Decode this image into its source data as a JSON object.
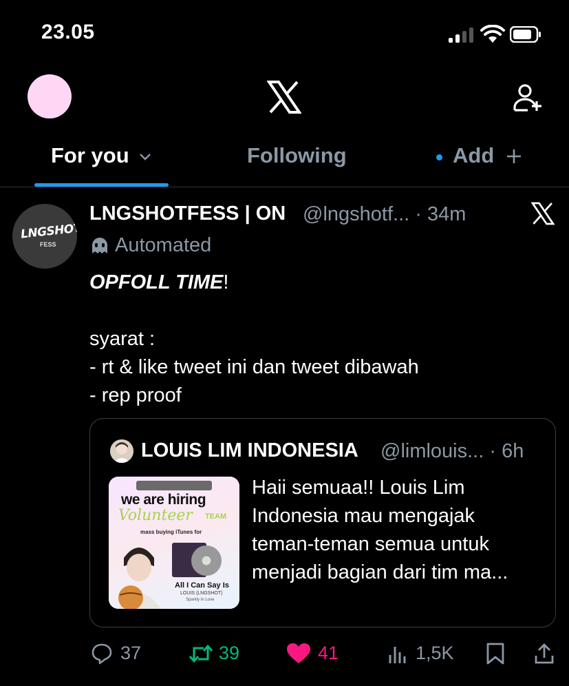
{
  "status_bar": {
    "time": "23.05"
  },
  "header": {
    "avatar_color": "#ffd7f4",
    "logo": "x-logo-icon",
    "add_account_icon": "add-user-icon"
  },
  "tabs": [
    {
      "label": "For you",
      "active": true,
      "has_chevron": true
    },
    {
      "label": "Following",
      "active": false
    },
    {
      "label": "Add",
      "active": false,
      "has_dot": true,
      "has_plus": true
    }
  ],
  "tweet": {
    "author_name": "LNGSHOTFESS | ON",
    "author_handle": "@lngshotf... · 34m",
    "avatar_text": "LNGSHOT",
    "avatar_subtext": "FESS",
    "automated_label": "Automated",
    "body": {
      "line1_emph": "OPFOLL TIME",
      "line1_rest": "!",
      "line2": "syarat :",
      "line3": "- rt & like tweet ini dan tweet dibawah",
      "line4": "- rep proof"
    },
    "quote": {
      "author_name": "LOUIS LIM INDONESIA",
      "author_handle": "@limlouis... · 6h",
      "text": "Haii semuaa!! Louis Lim Indonesia mau mengajak teman-teman semua untuk menjadi bagian dari tim ma...",
      "image": {
        "headline": "we are hiring",
        "script": "Volunteer",
        "team": "TEAM",
        "subtitle": "mass buying iTunes for",
        "song": "All I Can Say Is",
        "artist": "LOUIS (LNGSHOT)",
        "sub_artist": "Sparkly In Love"
      }
    },
    "actions": {
      "replies": "37",
      "retweets": "39",
      "likes": "41",
      "views": "1,5K"
    }
  },
  "colors": {
    "accent": "#1d9bf0",
    "retweet": "#00ba7c",
    "like": "#f91880",
    "muted": "#8b98a5"
  }
}
